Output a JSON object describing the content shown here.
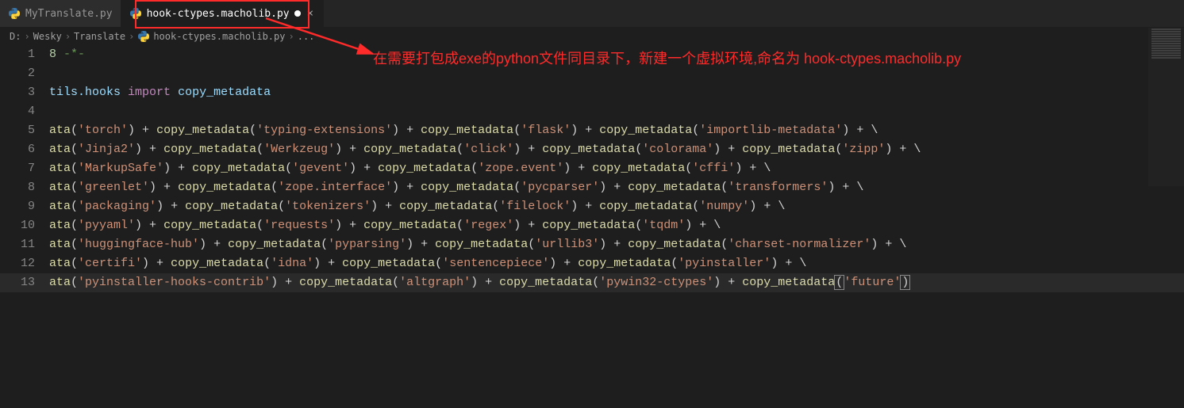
{
  "tabs": [
    {
      "label": "MyTranslate.py",
      "active": false,
      "modified": false
    },
    {
      "label": "hook-ctypes.macholib.py",
      "active": true,
      "modified": true
    }
  ],
  "breadcrumbs": {
    "root": "D:",
    "parts": [
      "Wesky",
      "Translate"
    ],
    "file": "hook-ctypes.macholib.py",
    "more": "..."
  },
  "annotation_text": "在需要打包成exe的python文件同目录下，新建一个虚拟环境,命名为 hook-ctypes.macholib.py",
  "code": {
    "lines": [
      {
        "n": 1,
        "tokens": [
          [
            "num",
            "8"
          ],
          [
            "op",
            " "
          ],
          [
            "cm",
            "-*-"
          ]
        ]
      },
      {
        "n": 2,
        "tokens": []
      },
      {
        "n": 3,
        "tokens": [
          [
            "id",
            "tils.hooks"
          ],
          [
            "op",
            " "
          ],
          [
            "kw",
            "import"
          ],
          [
            "op",
            " "
          ],
          [
            "id",
            "copy_metadata"
          ]
        ]
      },
      {
        "n": 4,
        "tokens": []
      },
      {
        "n": 5,
        "tokens": [
          [
            "func",
            "ata"
          ],
          [
            "op",
            "("
          ],
          [
            "str",
            "'torch'"
          ],
          [
            "op",
            ") + "
          ],
          [
            "func",
            "copy_metadata"
          ],
          [
            "op",
            "("
          ],
          [
            "str",
            "'typing-extensions'"
          ],
          [
            "op",
            ") + "
          ],
          [
            "func",
            "copy_metadata"
          ],
          [
            "op",
            "("
          ],
          [
            "str",
            "'flask'"
          ],
          [
            "op",
            ") + "
          ],
          [
            "func",
            "copy_metadata"
          ],
          [
            "op",
            "("
          ],
          [
            "str",
            "'importlib-metadata'"
          ],
          [
            "op",
            ") + \\"
          ]
        ]
      },
      {
        "n": 6,
        "tokens": [
          [
            "func",
            "ata"
          ],
          [
            "op",
            "("
          ],
          [
            "str",
            "'Jinja2'"
          ],
          [
            "op",
            ") + "
          ],
          [
            "func",
            "copy_metadata"
          ],
          [
            "op",
            "("
          ],
          [
            "str",
            "'Werkzeug'"
          ],
          [
            "op",
            ") + "
          ],
          [
            "func",
            "copy_metadata"
          ],
          [
            "op",
            "("
          ],
          [
            "str",
            "'click'"
          ],
          [
            "op",
            ") + "
          ],
          [
            "func",
            "copy_metadata"
          ],
          [
            "op",
            "("
          ],
          [
            "str",
            "'colorama'"
          ],
          [
            "op",
            ") + "
          ],
          [
            "func",
            "copy_metadata"
          ],
          [
            "op",
            "("
          ],
          [
            "str",
            "'zipp'"
          ],
          [
            "op",
            ") + \\"
          ]
        ]
      },
      {
        "n": 7,
        "tokens": [
          [
            "func",
            "ata"
          ],
          [
            "op",
            "("
          ],
          [
            "str",
            "'MarkupSafe'"
          ],
          [
            "op",
            ") + "
          ],
          [
            "func",
            "copy_metadata"
          ],
          [
            "op",
            "("
          ],
          [
            "str",
            "'gevent'"
          ],
          [
            "op",
            ") + "
          ],
          [
            "func",
            "copy_metadata"
          ],
          [
            "op",
            "("
          ],
          [
            "str",
            "'zope.event'"
          ],
          [
            "op",
            ") + "
          ],
          [
            "func",
            "copy_metadata"
          ],
          [
            "op",
            "("
          ],
          [
            "str",
            "'cffi'"
          ],
          [
            "op",
            ") + \\"
          ]
        ]
      },
      {
        "n": 8,
        "tokens": [
          [
            "func",
            "ata"
          ],
          [
            "op",
            "("
          ],
          [
            "str",
            "'greenlet'"
          ],
          [
            "op",
            ") + "
          ],
          [
            "func",
            "copy_metadata"
          ],
          [
            "op",
            "("
          ],
          [
            "str",
            "'zope.interface'"
          ],
          [
            "op",
            ") + "
          ],
          [
            "func",
            "copy_metadata"
          ],
          [
            "op",
            "("
          ],
          [
            "str",
            "'pycparser'"
          ],
          [
            "op",
            ") + "
          ],
          [
            "func",
            "copy_metadata"
          ],
          [
            "op",
            "("
          ],
          [
            "str",
            "'transformers'"
          ],
          [
            "op",
            ") + \\"
          ]
        ]
      },
      {
        "n": 9,
        "tokens": [
          [
            "func",
            "ata"
          ],
          [
            "op",
            "("
          ],
          [
            "str",
            "'packaging'"
          ],
          [
            "op",
            ") + "
          ],
          [
            "func",
            "copy_metadata"
          ],
          [
            "op",
            "("
          ],
          [
            "str",
            "'tokenizers'"
          ],
          [
            "op",
            ") + "
          ],
          [
            "func",
            "copy_metadata"
          ],
          [
            "op",
            "("
          ],
          [
            "str",
            "'filelock'"
          ],
          [
            "op",
            ") + "
          ],
          [
            "func",
            "copy_metadata"
          ],
          [
            "op",
            "("
          ],
          [
            "str",
            "'numpy'"
          ],
          [
            "op",
            ") + \\"
          ]
        ]
      },
      {
        "n": 10,
        "tokens": [
          [
            "func",
            "ata"
          ],
          [
            "op",
            "("
          ],
          [
            "str",
            "'pyyaml'"
          ],
          [
            "op",
            ") + "
          ],
          [
            "func",
            "copy_metadata"
          ],
          [
            "op",
            "("
          ],
          [
            "str",
            "'requests'"
          ],
          [
            "op",
            ") + "
          ],
          [
            "func",
            "copy_metadata"
          ],
          [
            "op",
            "("
          ],
          [
            "str",
            "'regex'"
          ],
          [
            "op",
            ") + "
          ],
          [
            "func",
            "copy_metadata"
          ],
          [
            "op",
            "("
          ],
          [
            "str",
            "'tqdm'"
          ],
          [
            "op",
            ") + \\"
          ]
        ]
      },
      {
        "n": 11,
        "tokens": [
          [
            "func",
            "ata"
          ],
          [
            "op",
            "("
          ],
          [
            "str",
            "'huggingface-hub'"
          ],
          [
            "op",
            ") + "
          ],
          [
            "func",
            "copy_metadata"
          ],
          [
            "op",
            "("
          ],
          [
            "str",
            "'pyparsing'"
          ],
          [
            "op",
            ") + "
          ],
          [
            "func",
            "copy_metadata"
          ],
          [
            "op",
            "("
          ],
          [
            "str",
            "'urllib3'"
          ],
          [
            "op",
            ") + "
          ],
          [
            "func",
            "copy_metadata"
          ],
          [
            "op",
            "("
          ],
          [
            "str",
            "'charset-normalizer'"
          ],
          [
            "op",
            ") + \\"
          ]
        ]
      },
      {
        "n": 12,
        "tokens": [
          [
            "func",
            "ata"
          ],
          [
            "op",
            "("
          ],
          [
            "str",
            "'certifi'"
          ],
          [
            "op",
            ") + "
          ],
          [
            "func",
            "copy_metadata"
          ],
          [
            "op",
            "("
          ],
          [
            "str",
            "'idna'"
          ],
          [
            "op",
            ") + "
          ],
          [
            "func",
            "copy_metadata"
          ],
          [
            "op",
            "("
          ],
          [
            "str",
            "'sentencepiece'"
          ],
          [
            "op",
            ") + "
          ],
          [
            "func",
            "copy_metadata"
          ],
          [
            "op",
            "("
          ],
          [
            "str",
            "'pyinstaller'"
          ],
          [
            "op",
            ") + \\"
          ]
        ]
      },
      {
        "n": 13,
        "tokens": [
          [
            "func",
            "ata"
          ],
          [
            "op",
            "("
          ],
          [
            "str",
            "'pyinstaller-hooks-contrib'"
          ],
          [
            "op",
            ") + "
          ],
          [
            "func",
            "copy_metadata"
          ],
          [
            "op",
            "("
          ],
          [
            "str",
            "'altgraph'"
          ],
          [
            "op",
            ") + "
          ],
          [
            "func",
            "copy_metadata"
          ],
          [
            "op",
            "("
          ],
          [
            "str",
            "'pywin32-ctypes'"
          ],
          [
            "op",
            ") + "
          ],
          [
            "func",
            "copy_metadata"
          ],
          [
            "brk",
            "("
          ],
          [
            "str",
            "'future'"
          ],
          [
            "brk",
            ")"
          ]
        ]
      }
    ]
  }
}
